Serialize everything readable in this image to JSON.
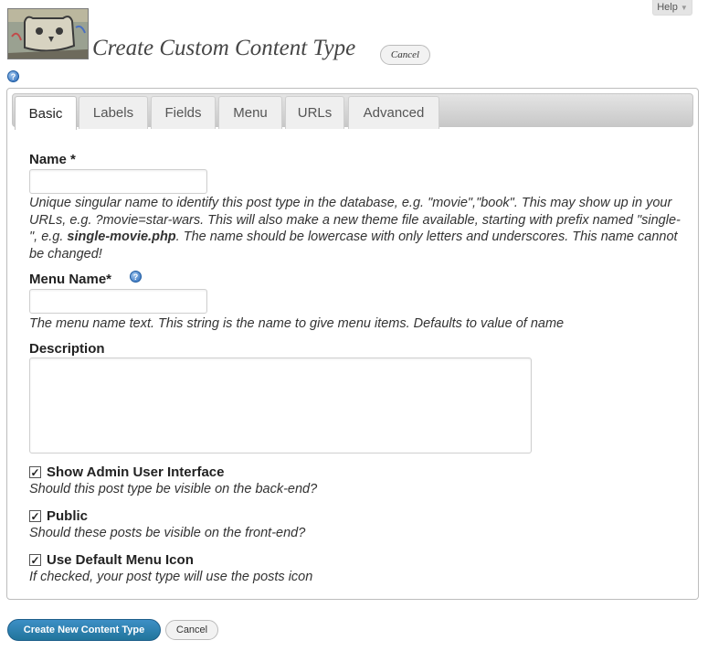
{
  "header": {
    "title": "Create Custom Content Type",
    "cancel_label": "Cancel",
    "help_tab_label": "Help"
  },
  "tabs": [
    {
      "label": "Basic",
      "active": true
    },
    {
      "label": "Labels",
      "active": false
    },
    {
      "label": "Fields",
      "active": false
    },
    {
      "label": "Menu",
      "active": false
    },
    {
      "label": "URLs",
      "active": false
    },
    {
      "label": "Advanced",
      "active": false
    }
  ],
  "form": {
    "name": {
      "label": "Name *",
      "value": "",
      "desc_part1": "Unique singular name to identify this post type in the database, e.g. \"movie\",\"book\". This may show up in your URLs, e.g. ?movie=star-wars. This will also make a new theme file available, starting with prefix named \"single-\", e.g. ",
      "desc_bold": "single-movie.php",
      "desc_part2": ". The name should be lowercase with only letters and underscores. This name cannot be changed!"
    },
    "menu_name": {
      "label": "Menu Name*",
      "value": "",
      "desc": "The menu name text. This string is the name to give menu items. Defaults to value of name"
    },
    "description": {
      "label": "Description",
      "value": ""
    },
    "show_admin_ui": {
      "label": "Show Admin User Interface",
      "checked": true,
      "desc": "Should this post type be visible on the back-end?"
    },
    "public": {
      "label": "Public",
      "checked": true,
      "desc": "Should these posts be visible on the front-end?"
    },
    "default_menu_icon": {
      "label": "Use Default Menu Icon",
      "checked": true,
      "desc": "If checked, your post type will use the posts icon"
    }
  },
  "footer": {
    "submit_label": "Create New Content Type",
    "cancel_label": "Cancel"
  },
  "colors": {
    "primary_button": "#21759b",
    "help_icon": "#2a69b8"
  }
}
